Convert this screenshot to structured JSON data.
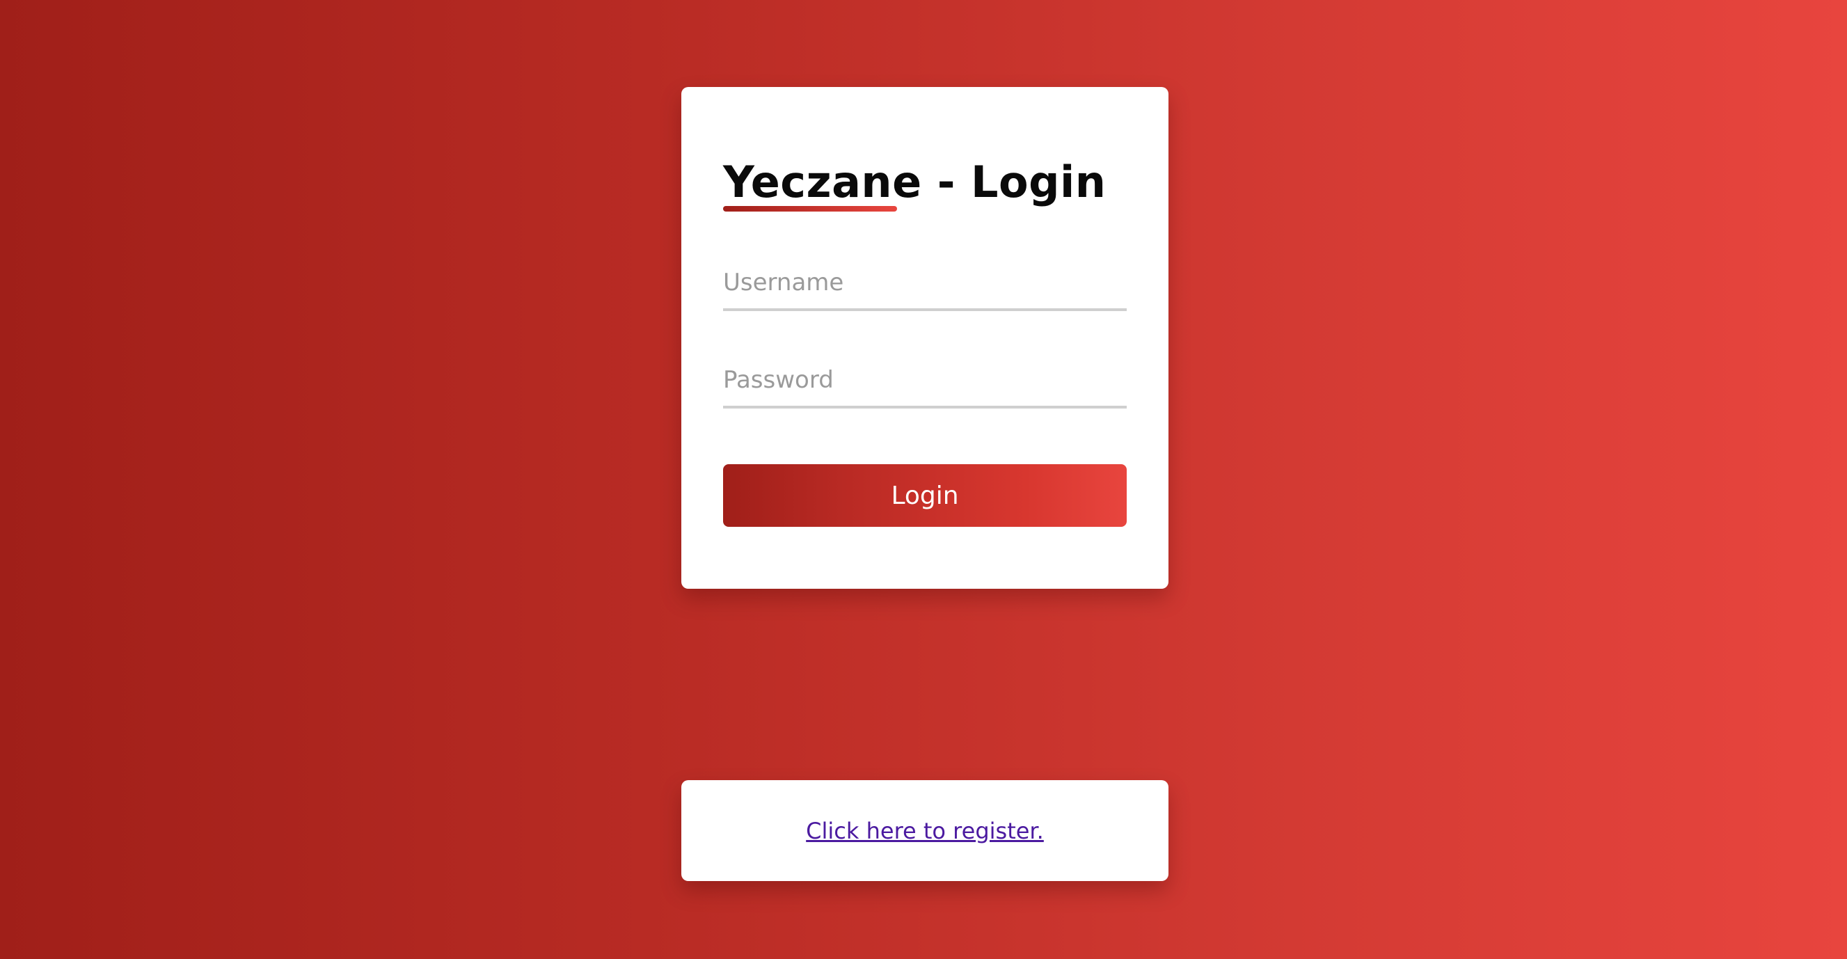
{
  "login": {
    "title_brand": "Yeczane",
    "title_rest": " - Login",
    "username_placeholder": "Username",
    "password_placeholder": "Password",
    "button_label": "Login"
  },
  "register": {
    "link_label": "Click here to register."
  },
  "colors": {
    "gradient_start": "#a01f19",
    "gradient_end": "#e8453e",
    "link": "#4b1aa0"
  }
}
